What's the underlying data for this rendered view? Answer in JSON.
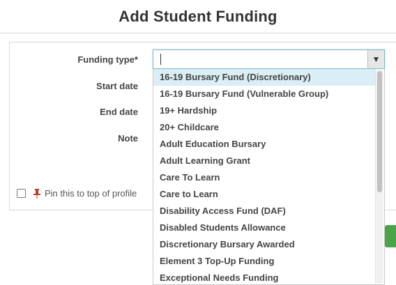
{
  "dialog": {
    "title": "Add Student Funding"
  },
  "form": {
    "funding_type_label": "Funding type*",
    "start_date_label": "Start date",
    "end_date_label": "End date",
    "note_label": "Note",
    "pin_label": "Pin this to top of profile",
    "funding_type_value": ""
  },
  "dropdown": {
    "highlighted_index": 0,
    "options": [
      "16-19 Bursary Fund (Discretionary)",
      "16-19 Bursary Fund (Vulnerable Group)",
      "19+ Hardship",
      "20+ Childcare",
      "Adult Education Bursary",
      "Adult Learning Grant",
      "Care To Learn",
      "Care to Learn",
      "Disability Access Fund (DAF)",
      "Disabled Students Allowance",
      "Discretionary Bursary Awarded",
      "Element 3 Top-Up Funding",
      "Exceptional Needs Funding"
    ]
  },
  "icons": {
    "arrow": "chevron-down-icon",
    "pin": "pin-icon"
  },
  "colors": {
    "accent_green": "#4aa449",
    "highlight": "#d9eef5",
    "pin": "#c0392b"
  }
}
